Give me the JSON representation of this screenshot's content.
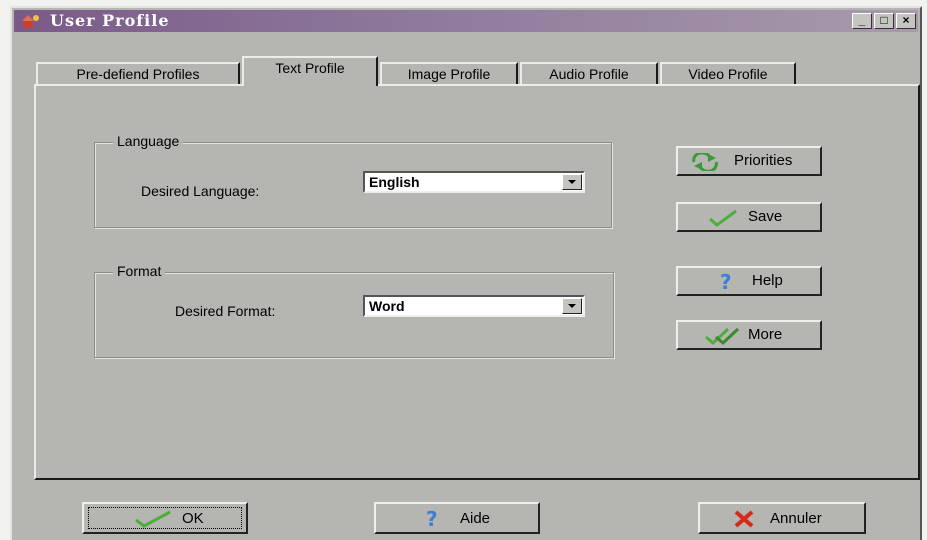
{
  "window": {
    "title": "User Profile"
  },
  "titlebar_buttons": {
    "minimize": "_",
    "maximize": "□",
    "close": "×"
  },
  "tabs": [
    {
      "label": "Pre-defiend Profiles"
    },
    {
      "label": "Text Profile",
      "active": true
    },
    {
      "label": "Image Profile"
    },
    {
      "label": "Audio Profile"
    },
    {
      "label": "Video Profile"
    }
  ],
  "language_group": {
    "title": "Language",
    "field_label": "Desired Language:",
    "value": "English"
  },
  "format_group": {
    "title": "Format",
    "field_label": "Desired Format:",
    "value": "Word"
  },
  "side_buttons": {
    "priorities": "Priorities",
    "save": "Save",
    "help": "Help",
    "more": "More"
  },
  "bottom_buttons": {
    "ok": "OK",
    "aide": "Aide",
    "annuler": "Annuler"
  },
  "icons": {
    "app": "user-profile-icon",
    "priorities": "refresh-arrows-icon",
    "save": "checkmark-icon",
    "help": "question-mark-icon",
    "more": "double-checkmark-icon",
    "ok": "checkmark-icon",
    "aide": "question-mark-icon",
    "annuler": "red-x-icon"
  },
  "colors": {
    "titlebar": "#7a5a88",
    "face": "#b5b5b1",
    "check_green": "#4caf3a",
    "help_blue": "#3b7fd6",
    "cancel_red": "#d62a1a"
  }
}
